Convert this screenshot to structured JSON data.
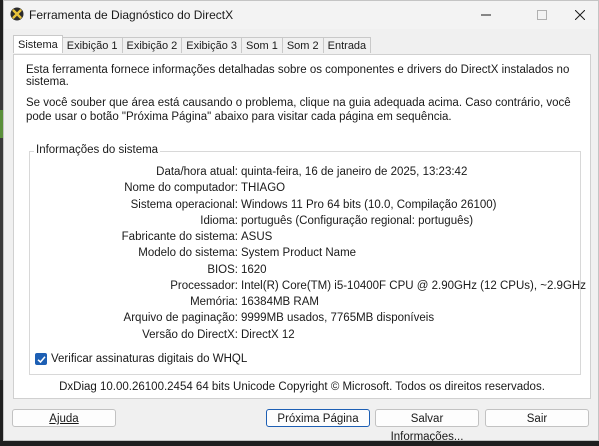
{
  "window": {
    "title": "Ferramenta de Diagnóstico do DirectX"
  },
  "tabs": [
    {
      "label": "Sistema",
      "active": true
    },
    {
      "label": "Exibição 1"
    },
    {
      "label": "Exibição 2"
    },
    {
      "label": "Exibição 3"
    },
    {
      "label": "Som 1"
    },
    {
      "label": "Som 2"
    },
    {
      "label": "Entrada"
    }
  ],
  "intro": {
    "line1": "Esta ferramenta fornece informações detalhadas sobre os componentes e drivers do DirectX instalados no sistema.",
    "line2": "Se você souber que área está causando o problema, clique na guia adequada acima. Caso contrário, você pode usar o botão \"Próxima Página\" abaixo para visitar cada página em sequência."
  },
  "system_info": {
    "group_title": "Informações do sistema",
    "rows": [
      {
        "label": "Data/hora atual:",
        "value": "quinta-feira, 16 de janeiro de 2025, 13:23:42"
      },
      {
        "label": "Nome do computador:",
        "value": "THIAGO"
      },
      {
        "label": "Sistema operacional:",
        "value": "Windows 11 Pro 64 bits (10.0, Compilação 26100)"
      },
      {
        "label": "Idioma:",
        "value": "português (Configuração regional: português)"
      },
      {
        "label": "Fabricante do sistema:",
        "value": "ASUS"
      },
      {
        "label": "Modelo do sistema:",
        "value": "System Product Name"
      },
      {
        "label": "BIOS:",
        "value": "1620"
      },
      {
        "label": "Processador:",
        "value": "Intel(R) Core(TM) i5-10400F CPU @ 2.90GHz (12 CPUs), ~2.9GHz"
      },
      {
        "label": "Memória:",
        "value": "16384MB RAM"
      },
      {
        "label": "Arquivo de paginação:",
        "value": "9999MB usados, 7765MB disponíveis"
      },
      {
        "label": "Versão do DirectX:",
        "value": "DirectX 12"
      }
    ]
  },
  "whql_checkbox": {
    "label": "Verificar assinaturas digitais do WHQL",
    "checked": true
  },
  "footer": "DxDiag 10.00.26100.2454 64 bits Unicode  Copyright © Microsoft. Todos os direitos reservados.",
  "buttons": {
    "help": "Ajuda",
    "next": "Próxima Página",
    "save": "Salvar Informações...",
    "exit": "Sair"
  },
  "colors": {
    "accent": "#1d5fb4",
    "window_bg": "#f0f0f0",
    "panel_bg": "#ffffff"
  }
}
